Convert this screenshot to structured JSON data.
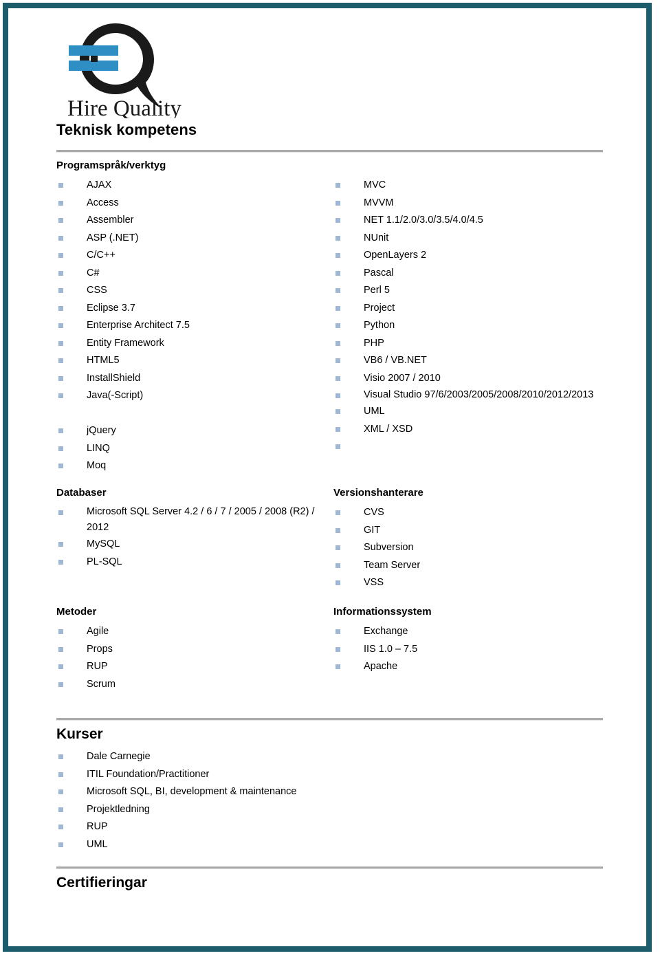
{
  "document": {
    "title": "Teknisk kompetens",
    "logo": {
      "name": "hire-quality-logo",
      "wordmark": "Hire Quality",
      "mark_color": "#1a1a1a",
      "bar_color": "#2f8fc4"
    },
    "frame_color": "#1d5c6b",
    "bullet_color": "#9fb6d4",
    "rule_color": "#aaaaaa"
  },
  "sections": {
    "programming": {
      "heading": "Programspråk/verktyg",
      "left_items": [
        "AJAX",
        "Access",
        "Assembler",
        "ASP (.NET)",
        "C/C++",
        "C#",
        "CSS",
        "Eclipse 3.7",
        "Enterprise Architect 7.5",
        "Entity Framework",
        "HTML5",
        "InstallShield",
        "Java(-Script)",
        "",
        "jQuery",
        "LINQ",
        "Moq"
      ],
      "right_items": [
        "MVC",
        "MVVM",
        "NET 1.1/2.0/3.0/3.5/4.0/4.5",
        "NUnit",
        "OpenLayers 2",
        "Pascal",
        "Perl 5",
        "Project",
        "Python",
        "PHP",
        "VB6 / VB.NET",
        "Visio 2007 / 2010",
        "Visual Studio 97/6/2003/2005/2008/2010/2012/2013",
        "UML",
        "XML / XSD",
        ""
      ]
    },
    "databases": {
      "heading": "Databaser",
      "items": [
        "Microsoft SQL Server 4.2 / 6 / 7 / 2005 / 2008 (R2) / 2012",
        "MySQL",
        "PL-SQL"
      ]
    },
    "version_control": {
      "heading": "Versionshanterare",
      "items": [
        "CVS",
        "GIT",
        "Subversion",
        "Team Server",
        "VSS"
      ]
    },
    "methods": {
      "heading": "Metoder",
      "items": [
        "Agile",
        "Props",
        "RUP",
        "Scrum"
      ]
    },
    "information_systems": {
      "heading": "Informationssystem",
      "items": [
        "Exchange",
        "IIS 1.0 – 7.5",
        "Apache"
      ]
    },
    "courses": {
      "heading": "Kurser",
      "items": [
        "Dale Carnegie",
        "ITIL Foundation/Practitioner",
        "Microsoft SQL, BI, development & maintenance",
        "Projektledning",
        "RUP",
        "UML"
      ]
    },
    "certifications": {
      "heading": "Certifieringar",
      "items": []
    }
  }
}
